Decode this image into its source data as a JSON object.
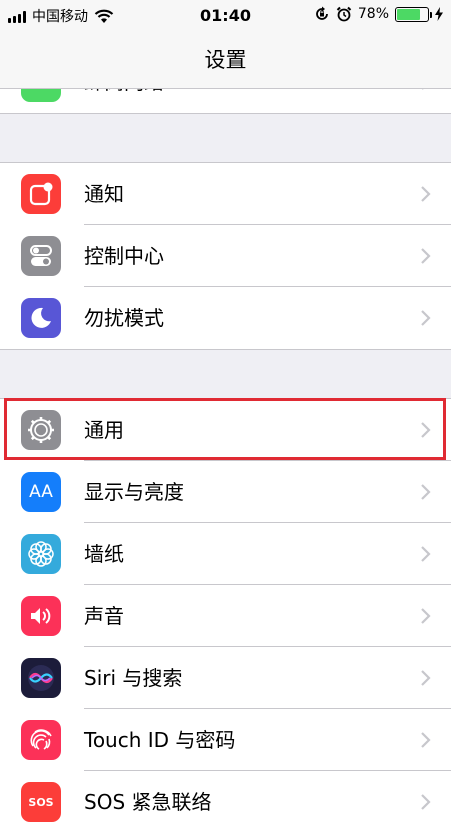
{
  "status_bar": {
    "carrier": "中国移动",
    "time": "01:40",
    "battery_percent": "78%",
    "battery_level": 0.78
  },
  "nav": {
    "title": "设置"
  },
  "top_row": {
    "label": "蜂窝网络",
    "value": "",
    "icon": "cellular-icon",
    "icon_color": "#4cd964"
  },
  "group2": [
    {
      "label": "通知",
      "icon": "notifications-icon",
      "icon_color": "#fc3d39"
    },
    {
      "label": "控制中心",
      "icon": "control-center-icon",
      "icon_color": "#8e8e93"
    },
    {
      "label": "勿扰模式",
      "icon": "moon-icon",
      "icon_color": "#5856d6"
    }
  ],
  "group3": [
    {
      "label": "通用",
      "icon": "gear-icon",
      "icon_color": "#8e8e93",
      "highlighted": true
    },
    {
      "label": "显示与亮度",
      "icon": "display-brightness-icon",
      "icon_color": "#147efb",
      "icon_text": "AA"
    },
    {
      "label": "墙纸",
      "icon": "wallpaper-flower-icon",
      "icon_color": "#34aadc"
    },
    {
      "label": "声音",
      "icon": "speaker-icon",
      "icon_color": "#fc3158"
    },
    {
      "label": "Siri 与搜索",
      "icon": "siri-icon",
      "icon_color": "#1c1c3a"
    },
    {
      "label": "Touch ID 与密码",
      "icon": "fingerprint-icon",
      "icon_color": "#fc3158"
    },
    {
      "label": "SOS 紧急联络",
      "icon": "sos-icon",
      "icon_color": "#fc3d39",
      "icon_text": "SOS"
    }
  ],
  "colors": {
    "highlight_border": "#e02a33",
    "chevron": "#c7c7cc"
  }
}
